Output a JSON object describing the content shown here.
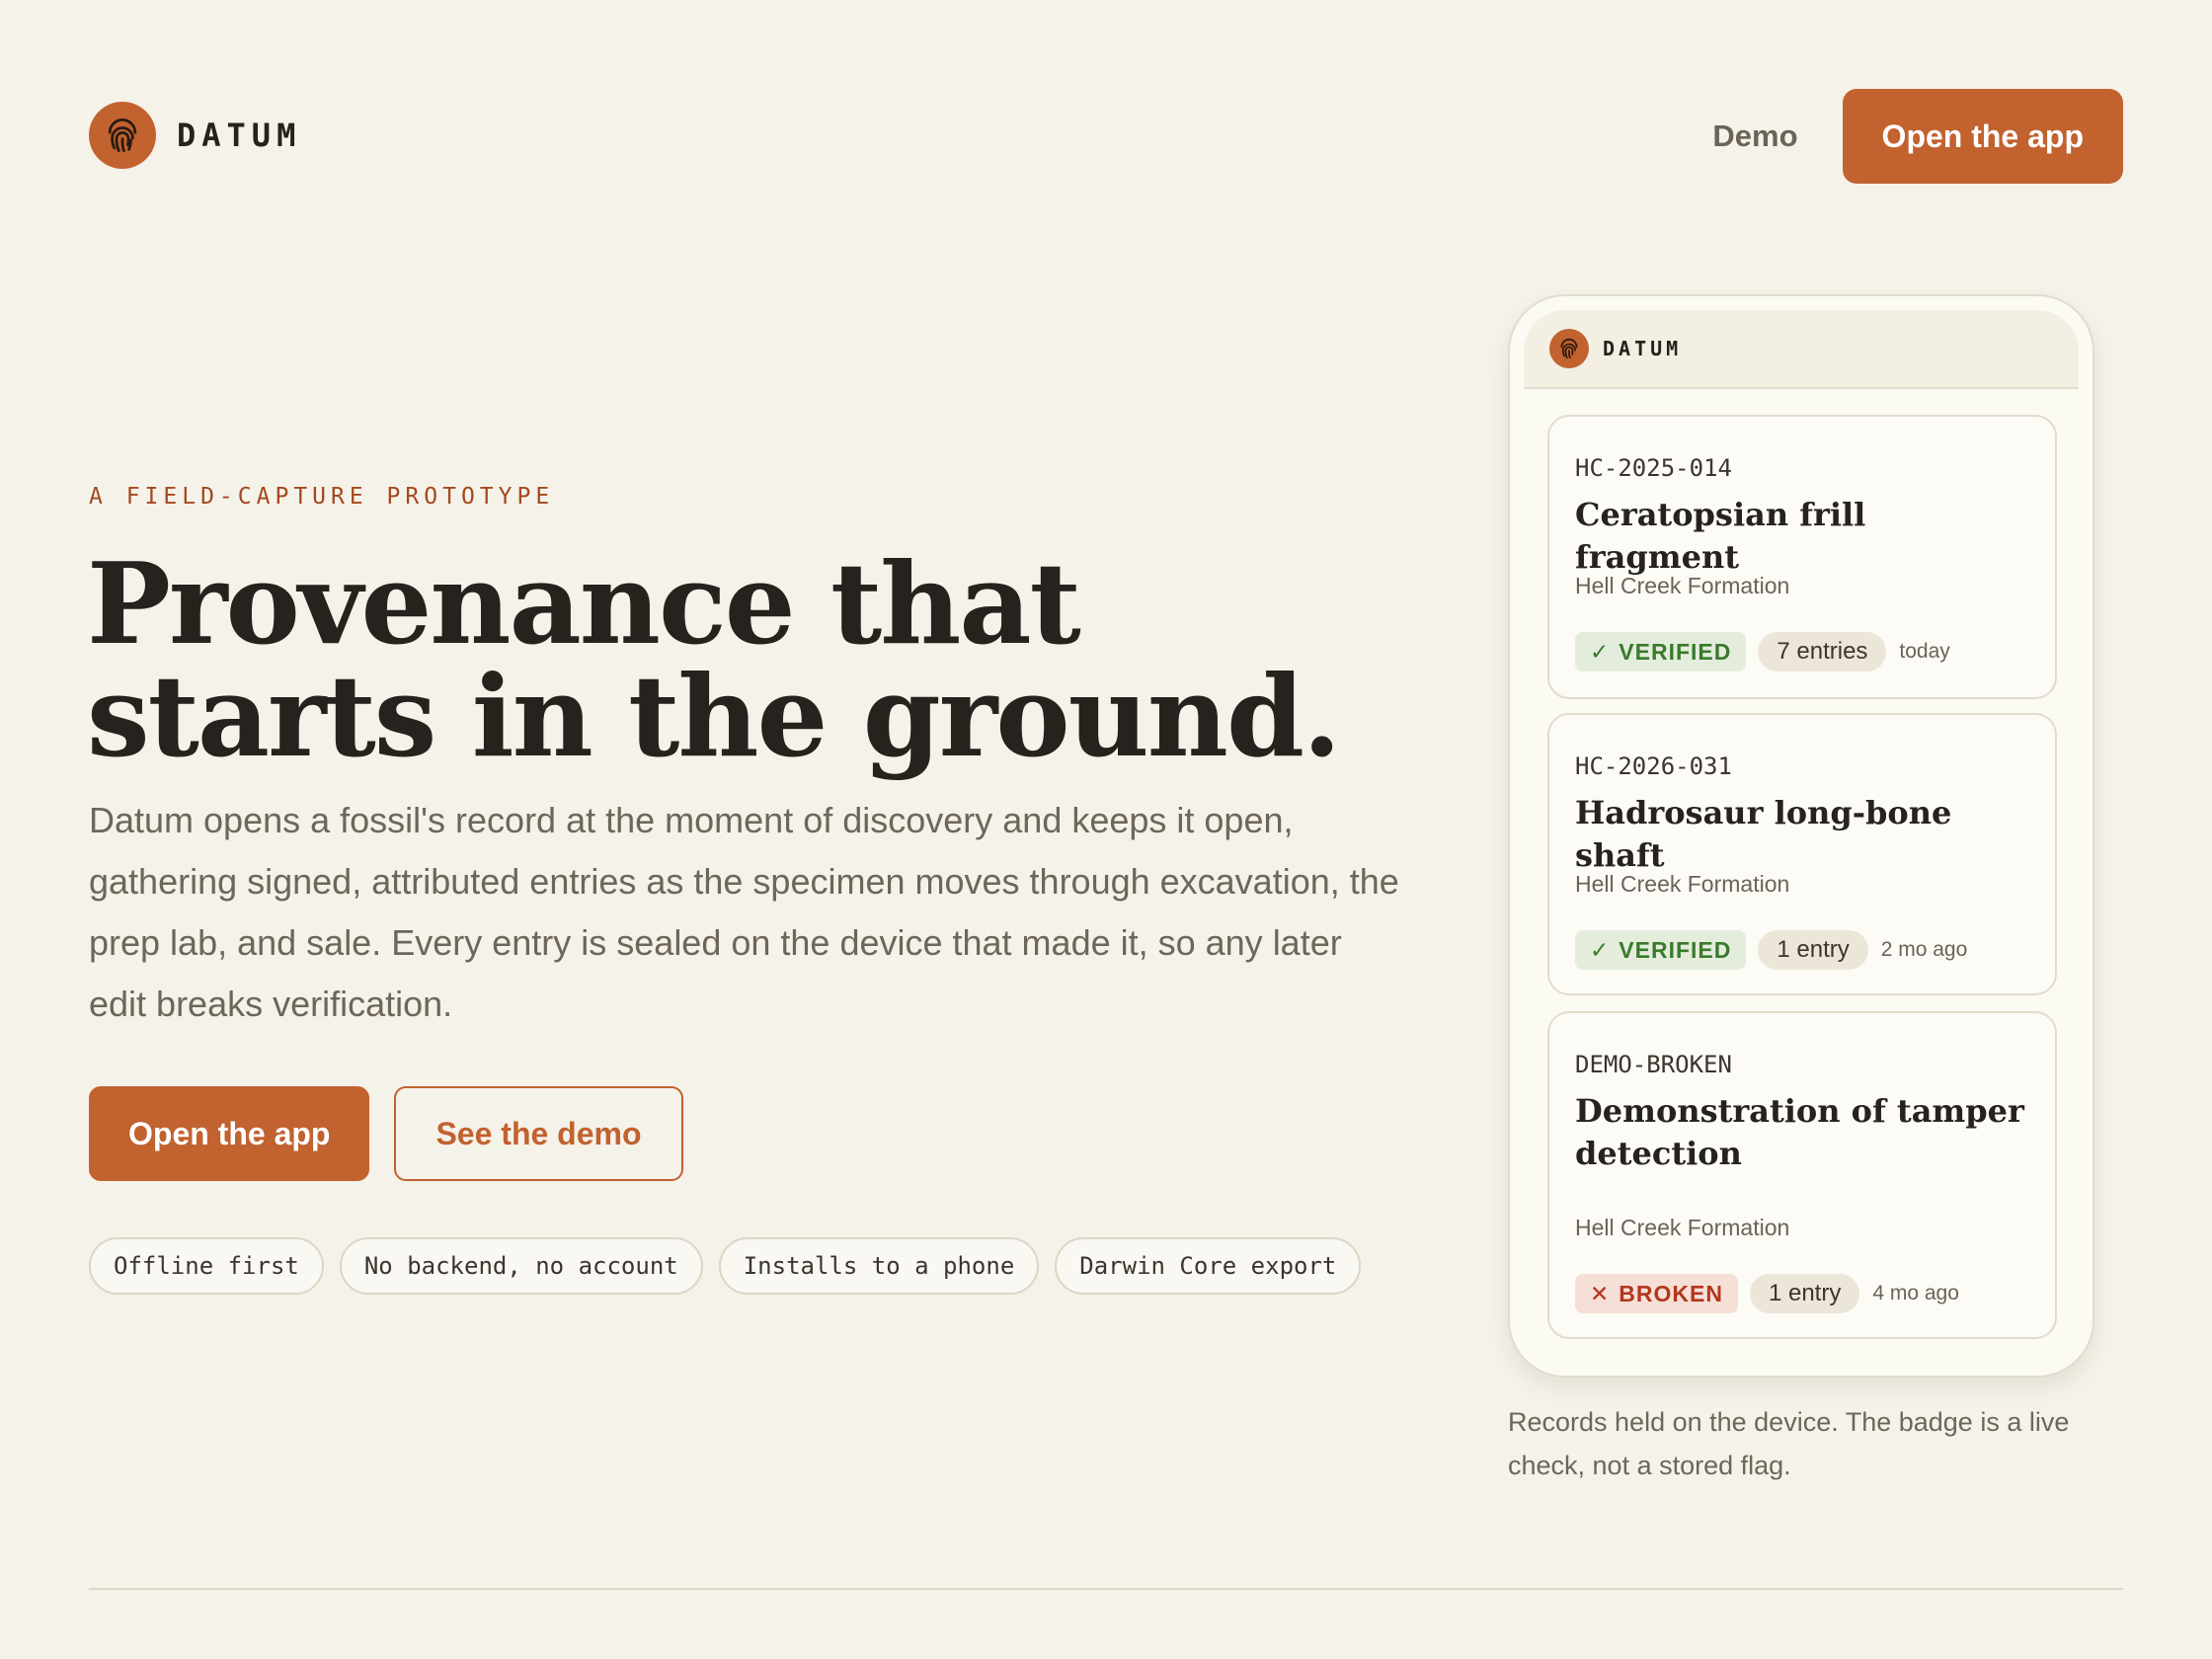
{
  "brand": {
    "name": "DATUM",
    "logo_icon": "fingerprint-icon",
    "accent_color": "#c1622f"
  },
  "nav": {
    "demo_label": "Demo",
    "open_app_label": "Open the app"
  },
  "hero": {
    "eyebrow": "A FIELD-CAPTURE PROTOTYPE",
    "headline_line1": "Provenance that",
    "headline_line2": "starts in the ground.",
    "lede": "Datum opens a fossil's record at the moment of discovery and keeps it open, gathering signed, attributed entries as the specimen moves through excavation, the prep lab, and sale. Every entry is sealed on the device that made it, so any later edit breaks verification.",
    "primary_cta": "Open the app",
    "secondary_cta": "See the demo",
    "chips": [
      "Offline first",
      "No backend, no account",
      "Installs to a phone",
      "Darwin Core export"
    ]
  },
  "phone": {
    "brand": "DATUM",
    "records": [
      {
        "id": "HC-2025-014",
        "title": "Ceratopsian frill fragment",
        "location": "Hell Creek Formation",
        "status": "VERIFIED",
        "status_icon": "check-icon",
        "status_color": "#3a7a2e",
        "entries": "7 entries",
        "ago": "today"
      },
      {
        "id": "HC-2026-031",
        "title": "Hadrosaur long-bone shaft",
        "location": "Hell Creek Formation",
        "status": "VERIFIED",
        "status_icon": "check-icon",
        "status_color": "#3a7a2e",
        "entries": "1 entry",
        "ago": "2 mo ago"
      },
      {
        "id": "DEMO-BROKEN",
        "title": "Demonstration of tamper detection",
        "location": "Hell Creek Formation",
        "status": "BROKEN",
        "status_icon": "x-icon",
        "status_color": "#b3361e",
        "entries": "1 entry",
        "ago": "4 mo ago"
      }
    ],
    "caption": "Records held on the device. The badge is a live check, not a stored flag."
  }
}
